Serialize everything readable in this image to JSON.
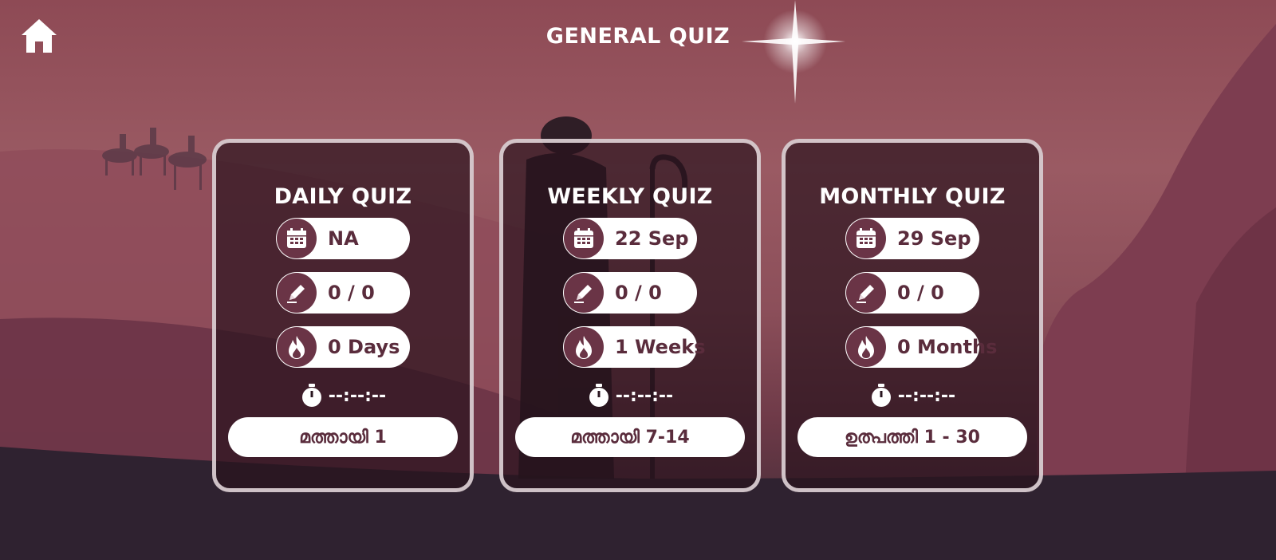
{
  "header": {
    "title": "GENERAL QUIZ",
    "home_icon": "home-icon"
  },
  "theme": {
    "card_text": "#5a2c3c",
    "icon_bg": "#6a3446",
    "background": "#8e4a55"
  },
  "cards": [
    {
      "title": "DAILY QUIZ",
      "date": "NA",
      "score": "0 / 0",
      "streak": "0 Days",
      "timer": "--:--:--",
      "action": "മത്തായി 1"
    },
    {
      "title": "WEEKLY QUIZ",
      "date": "22 Sep",
      "score": "0 / 0",
      "streak": "1 Weeks",
      "timer": "--:--:--",
      "action": "മത്തായി 7-14"
    },
    {
      "title": "MONTHLY QUIZ",
      "date": "29 Sep",
      "score": "0 / 0",
      "streak": "0 Months",
      "timer": "--:--:--",
      "action": "ഉത്പത്തി 1 - 30"
    }
  ]
}
